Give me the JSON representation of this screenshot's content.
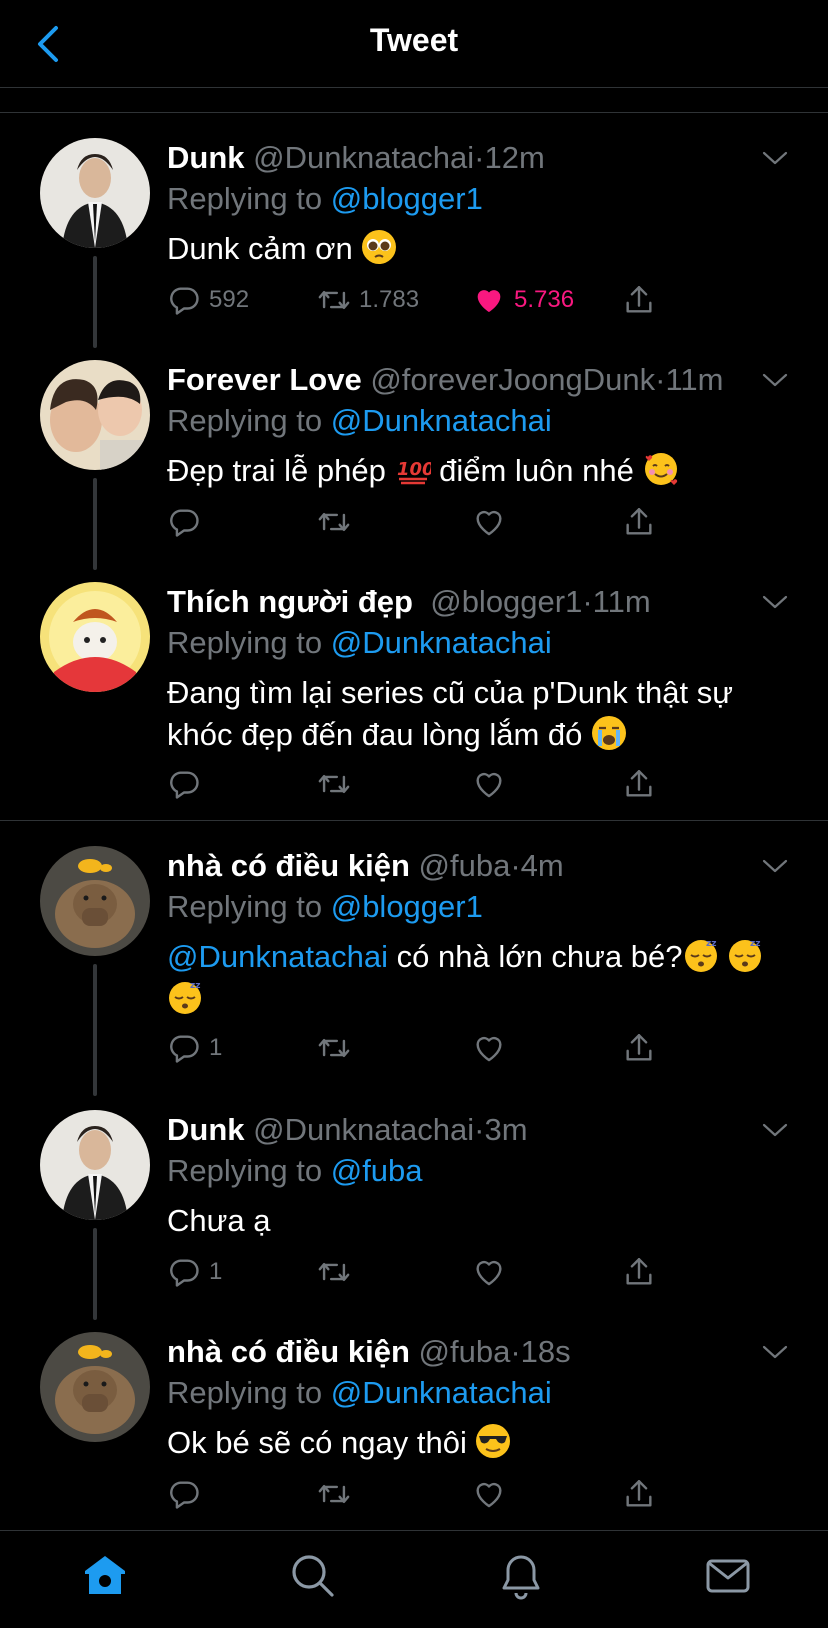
{
  "header": {
    "title": "Tweet"
  },
  "tweets": [
    {
      "name": "Dunk",
      "handle": "@Dunknatachai",
      "dot": "·",
      "time": "12m",
      "replying_prefix": "Replying to ",
      "replying_to": "@blogger1",
      "text": "Dunk cảm ơn",
      "text_emoji": "pleading-face",
      "replies": "592",
      "retweets": "1.783",
      "likes": "5.736",
      "liked": true
    },
    {
      "name": "Forever Love",
      "handle": "@foreverJoongDunk",
      "dot": "·",
      "time": "11m",
      "replying_prefix": "Replying to ",
      "replying_to": "@Dunknatachai",
      "text_a": "Đẹp trai lễ phép",
      "text_emoji_a": "hundred-points",
      "text_b": "điểm luôn nhé",
      "text_emoji_b": "smiling-face-with-hearts",
      "replies": "",
      "retweets": "",
      "likes": ""
    },
    {
      "name": "Thích người đẹp",
      "handle": "@blogger1",
      "dot": "·",
      "time": "11m",
      "replying_prefix": "Replying to ",
      "replying_to": "@Dunknatachai",
      "text": "Đang tìm lại series cũ của p'Dunk thật sự khóc đẹp đến đau lòng lắm đó",
      "text_emoji": "loudly-crying-face",
      "replies": "",
      "retweets": "",
      "likes": ""
    },
    {
      "name": "nhà có điều kiện",
      "handle": "@fuba",
      "dot": "·",
      "time": "4m",
      "replying_prefix": "Replying to ",
      "replying_to": "@blogger1",
      "mention": "@Dunknatachai",
      "text": "có nhà lớn chưa bé?",
      "text_emoji": "sleeping-face",
      "replies": "1",
      "retweets": "",
      "likes": ""
    },
    {
      "name": "Dunk",
      "handle": "@Dunknatachai",
      "dot": "·",
      "time": "3m",
      "replying_prefix": "Replying to ",
      "replying_to": "@fuba",
      "text": "Chưa ạ",
      "replies": "1",
      "retweets": "",
      "likes": ""
    },
    {
      "name": "nhà có điều kiện",
      "handle": "@fuba",
      "dot": "·",
      "time": "18s",
      "replying_prefix": "Replying to ",
      "replying_to": "@Dunknatachai",
      "text": "Ok bé sẽ có ngay thôi",
      "text_emoji": "smiling-face-with-sunglasses",
      "replies": "",
      "retweets": "",
      "likes": ""
    }
  ],
  "tabbar": {
    "items": [
      "home-icon",
      "search-icon",
      "notifications-icon",
      "messages-icon"
    ]
  },
  "colors": {
    "accent": "#1d9bf0",
    "like": "#f91880",
    "muted": "#71767b",
    "background": "#000000"
  }
}
